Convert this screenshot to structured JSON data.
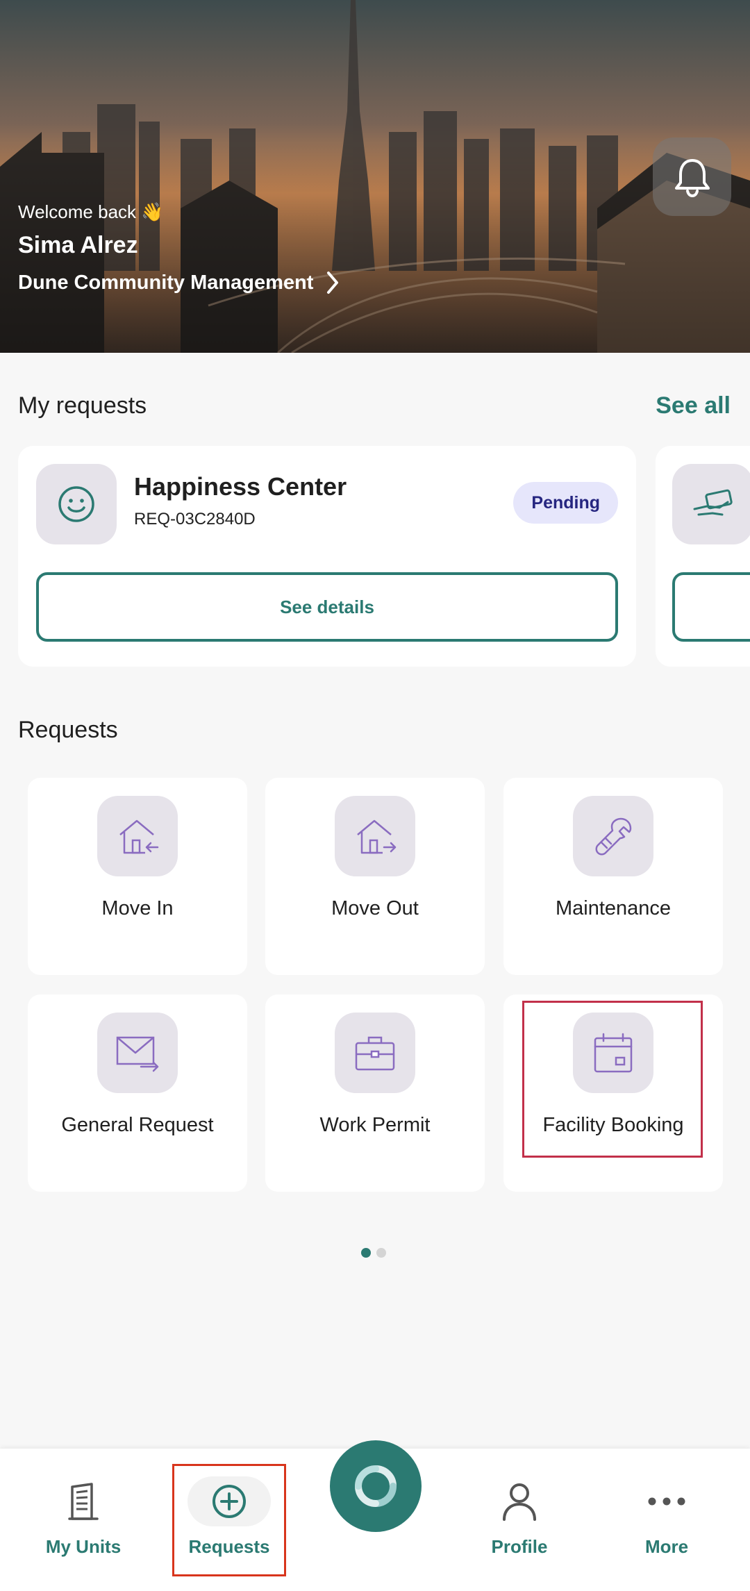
{
  "hero": {
    "welcome": "Welcome back 👋",
    "user_name": "Sima Alrez",
    "community": "Dune Community Management"
  },
  "my_requests": {
    "title": "My requests",
    "see_all": "See all",
    "cards": [
      {
        "title": "Happiness Center",
        "id": "REQ-03C2840D",
        "status": "Pending",
        "button": "See details",
        "icon": "smiley-icon"
      }
    ]
  },
  "requests": {
    "title": "Requests",
    "tiles": [
      {
        "label": "Move In",
        "icon": "move-in-icon"
      },
      {
        "label": "Move Out",
        "icon": "move-out-icon"
      },
      {
        "label": "Maintenance",
        "icon": "wrench-icon"
      },
      {
        "label": "General Request",
        "icon": "mail-forward-icon"
      },
      {
        "label": "Work Permit",
        "icon": "briefcase-icon"
      },
      {
        "label": "Facility Booking",
        "icon": "calendar-icon"
      }
    ]
  },
  "pagination": {
    "pages": 2,
    "current": 1
  },
  "bottom_nav": {
    "items": [
      {
        "label": "My Units",
        "icon": "building-icon"
      },
      {
        "label": "Requests",
        "icon": "plus-circle-icon"
      },
      {
        "label": "Profile",
        "icon": "person-icon"
      },
      {
        "label": "More",
        "icon": "more-dots-icon"
      }
    ]
  },
  "colors": {
    "accent": "#2b7a72",
    "icon_purple": "#8a6cc0",
    "badge_bg": "#e6e6fb",
    "badge_text": "#262680",
    "highlight_red": "#c2304a"
  }
}
